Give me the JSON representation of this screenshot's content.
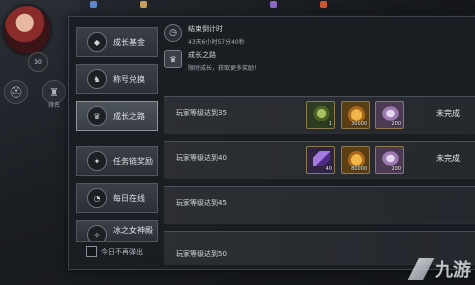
{
  "topbar": {
    "resources": [
      {
        "value": "",
        "color": "#5c88c9"
      },
      {
        "value": "",
        "color": "#c3a15b"
      },
      {
        "value": "",
        "color": "#8d6ac2"
      },
      {
        "value": "",
        "color": "#c9572f"
      }
    ]
  },
  "hud": {
    "player_level": "30",
    "icon_label": "排名"
  },
  "nav": {
    "items": [
      {
        "label": "成长基金",
        "icon": "fund-icon"
      },
      {
        "label": "称号兑换",
        "icon": "title-exchange-icon"
      },
      {
        "label": "成长之路",
        "icon": "growth-road-icon"
      },
      {
        "label": "任务链奖励",
        "icon": "quest-chain-icon"
      },
      {
        "label": "每日在线",
        "icon": "daily-online-icon"
      },
      {
        "label": "冰之女神殿",
        "icon": "goddess-icon"
      }
    ],
    "active_index": 2
  },
  "checkbox": {
    "label": "今日不再弹出"
  },
  "header": {
    "timer_title": "结束倒计时",
    "timer_value": "43天6小时57分40秒",
    "event_title": "成长之路",
    "event_desc": "限时成长，获取更多奖励！"
  },
  "rows": [
    {
      "task": "玩家等级达到35",
      "rewards": [
        {
          "type": "herb",
          "qty": "1",
          "color": "#6e8a3a"
        },
        {
          "type": "gold",
          "qty": "30000",
          "color": "#c98a2b"
        },
        {
          "type": "crystal",
          "qty": "200",
          "color": "#9d7bb0"
        }
      ],
      "status": "未完成"
    },
    {
      "task": "玩家等级达到40",
      "rewards": [
        {
          "type": "amethyst",
          "qty": "40",
          "color": "#7a4fb0"
        },
        {
          "type": "gold",
          "qty": "80000",
          "color": "#c98a2b"
        },
        {
          "type": "crystal",
          "qty": "200",
          "color": "#9d7bb0"
        }
      ],
      "status": "未完成"
    },
    {
      "task": "玩家等级达到45",
      "rewards": [],
      "status": ""
    },
    {
      "task": "玩家等级达到50",
      "rewards": [],
      "status": ""
    }
  ],
  "watermark": {
    "text": "九游"
  }
}
